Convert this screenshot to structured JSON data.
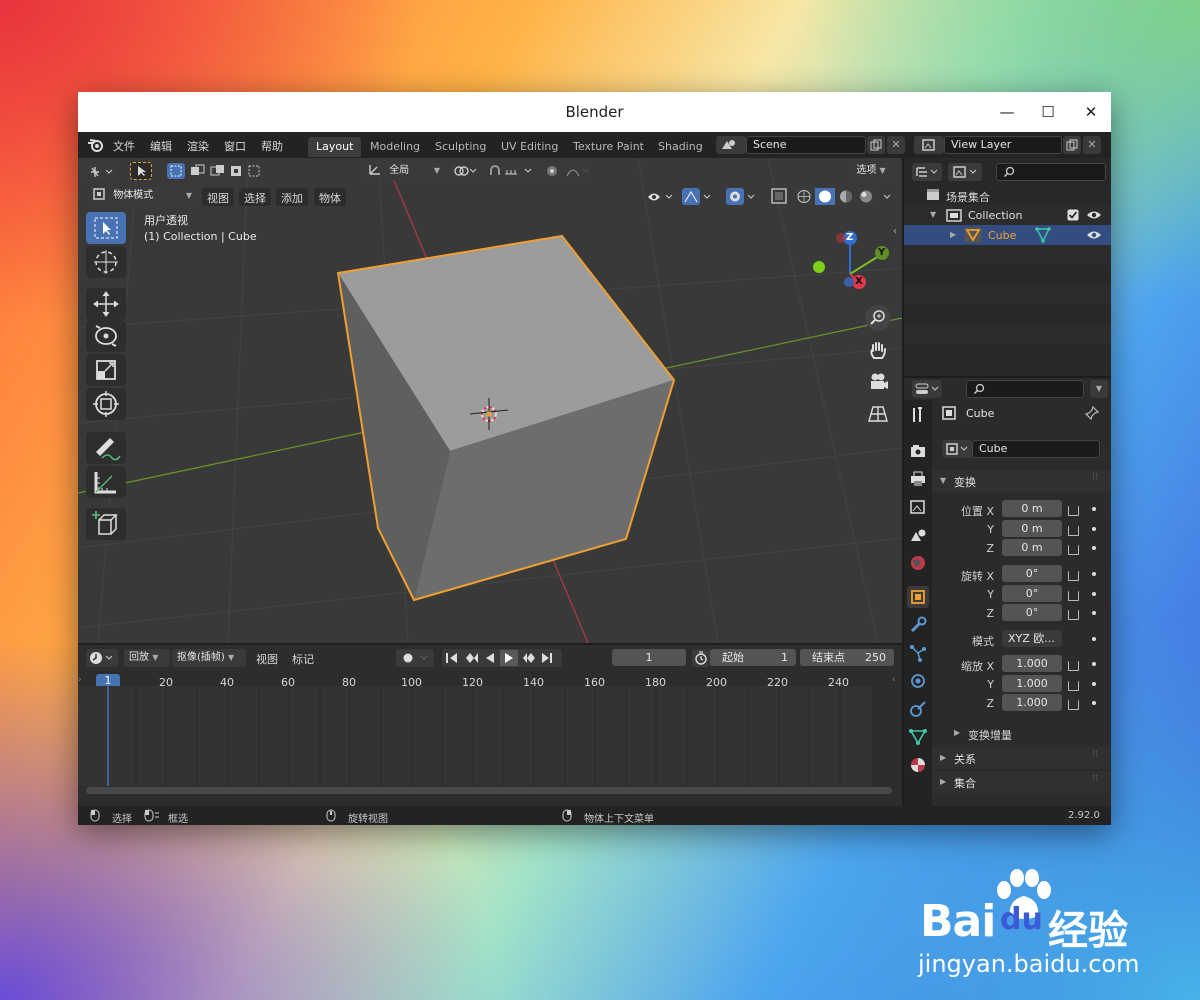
{
  "window": {
    "title": "Blender",
    "minimize": "—",
    "maximize": "☐",
    "close": "✕"
  },
  "menus": [
    "文件",
    "编辑",
    "渲染",
    "窗口",
    "帮助"
  ],
  "workspaces": [
    {
      "label": "Layout",
      "active": true
    },
    {
      "label": "Modeling"
    },
    {
      "label": "Sculpting"
    },
    {
      "label": "UV Editing"
    },
    {
      "label": "Texture Paint"
    },
    {
      "label": "Shading"
    }
  ],
  "scene": {
    "value": "Scene",
    "view_layer": "View Layer"
  },
  "viewport": {
    "transform_orientation": "全局",
    "options": "选项",
    "mode": "物体模式",
    "header_menus": [
      "视图",
      "选择",
      "添加",
      "物体"
    ],
    "view_label": "用户透视",
    "collection_label": "(1) Collection | Cube",
    "gizmo": {
      "z": "Z",
      "y": "Y",
      "x": "X"
    }
  },
  "outliner": {
    "scene_collection": "场景集合",
    "collection": "Collection",
    "object": "Cube"
  },
  "properties": {
    "object_name": "Cube",
    "data_name": "Cube",
    "transform_section": "变换",
    "location_label": "位置 X",
    "axis_y": "Y",
    "axis_z": "Z",
    "location": [
      "0 m",
      "0 m",
      "0 m"
    ],
    "rotation_label": "旋转 X",
    "rotation": [
      "0°",
      "0°",
      "0°"
    ],
    "mode_label": "模式",
    "rotation_mode": "XYZ 欧...",
    "scale_label": "缩放 X",
    "scale": [
      "1.000",
      "1.000",
      "1.000"
    ],
    "delta_transform": "变换增量",
    "relations": "关系",
    "collections": "集合"
  },
  "timeline": {
    "menus": [
      "回放",
      "抠像(插帧)",
      "视图",
      "标记"
    ],
    "current_frame": "1",
    "start_label": "起始",
    "start": "1",
    "end_label": "结束点",
    "end": "250",
    "ruler_current": "1",
    "ruler": [
      "20",
      "40",
      "60",
      "80",
      "100",
      "120",
      "140",
      "160",
      "180",
      "200",
      "220",
      "240"
    ]
  },
  "status": {
    "select": "选择",
    "box_select": "框选",
    "rotate_view": "旋转视图",
    "context_menu": "物体上下文菜单",
    "version": "2.92.0"
  },
  "watermark": {
    "text1": "Bai",
    "text2": "du",
    "text3": "经验",
    "url": "jingyan.baidu.com"
  },
  "colors": {
    "accent_blue": "#4772b3",
    "selection_orange": "#f0a030",
    "x_axis": "#e0394d",
    "y_axis": "#7fbb2b",
    "z_axis": "#2f6fd4"
  }
}
